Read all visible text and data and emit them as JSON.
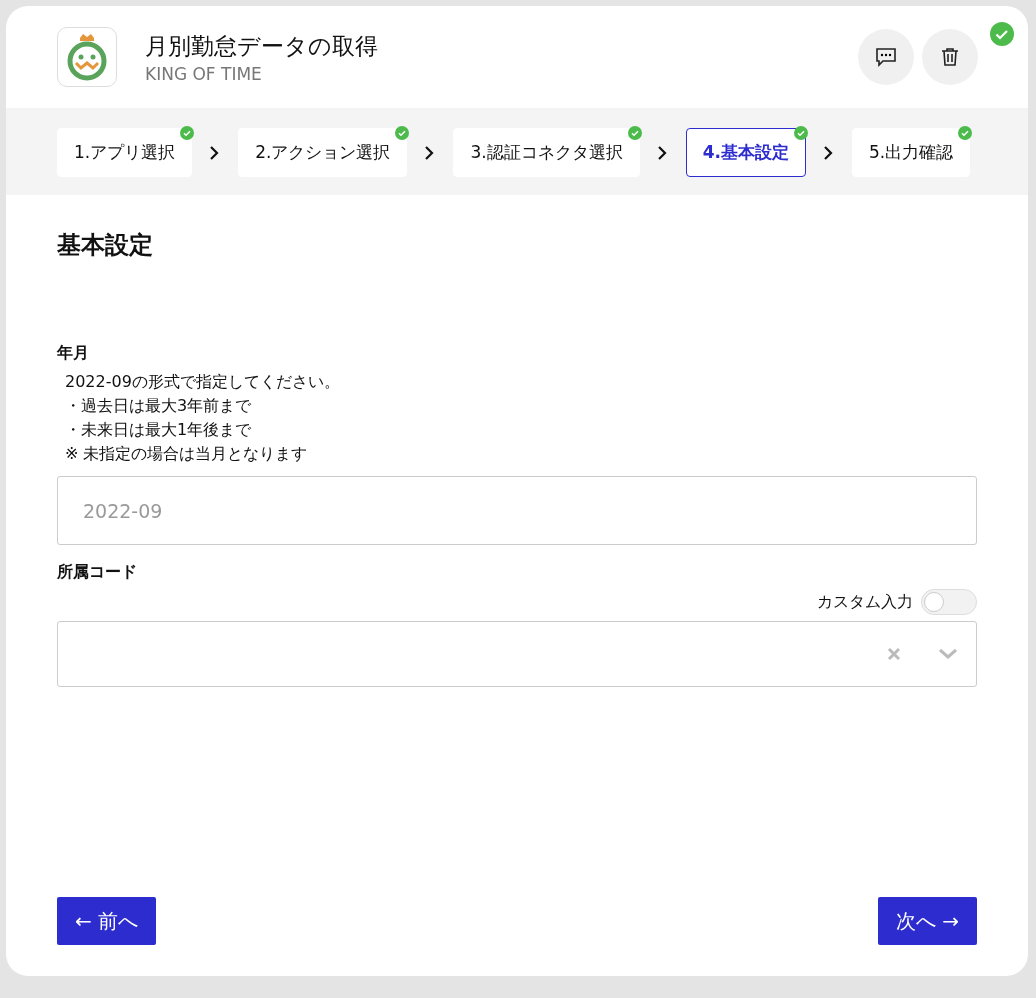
{
  "header": {
    "title": "月別勤怠データの取得",
    "subtitle": "KING OF TIME",
    "complete": true
  },
  "steps": [
    {
      "label": "1.アプリ選択",
      "selected": false,
      "done": true
    },
    {
      "label": "2.アクション選択",
      "selected": false,
      "done": true
    },
    {
      "label": "3.認証コネクタ選択",
      "selected": false,
      "done": true
    },
    {
      "label": "4.基本設定",
      "selected": true,
      "done": true
    },
    {
      "label": "5.出力確認",
      "selected": false,
      "done": true
    }
  ],
  "section_title": "基本設定",
  "fields": [
    {
      "kind": "text",
      "label": "年月",
      "help": [
        "2022-09の形式で指定してください。",
        "・過去日は最大3年前まで",
        "・未来日は最大1年後まで",
        "※ 未指定の場合は当月となります"
      ],
      "placeholder": "2022-09"
    },
    {
      "kind": "select",
      "label": "所属コード",
      "custom_label": "カスタム入力",
      "custom_on": false
    }
  ],
  "buttons": {
    "back": "← 前へ",
    "next": "次へ →"
  }
}
